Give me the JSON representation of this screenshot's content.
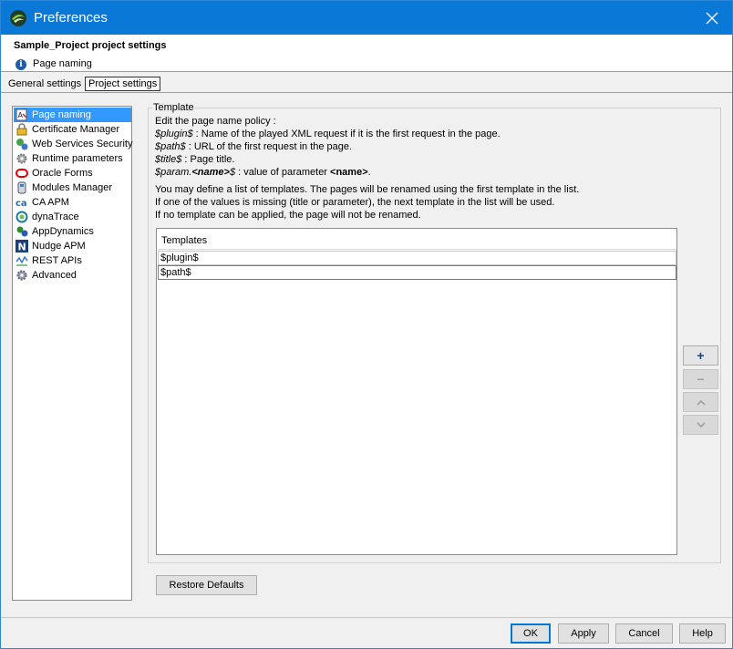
{
  "window": {
    "title": "Preferences"
  },
  "header": {
    "project_title": "Sample_Project project settings",
    "page_label": "Page naming"
  },
  "tabs": [
    {
      "label": "General settings",
      "active": false
    },
    {
      "label": "Project settings",
      "active": true
    }
  ],
  "sidebar": {
    "items": [
      {
        "label": "Page naming",
        "icon": "page-naming-icon",
        "selected": true
      },
      {
        "label": "Certificate Manager",
        "icon": "certificate-icon"
      },
      {
        "label": "Web Services Security",
        "icon": "web-services-icon"
      },
      {
        "label": "Runtime parameters",
        "icon": "runtime-gear-icon"
      },
      {
        "label": "Oracle Forms",
        "icon": "oracle-icon"
      },
      {
        "label": "Modules Manager",
        "icon": "modules-icon"
      },
      {
        "label": "CA APM",
        "icon": "ca-icon"
      },
      {
        "label": "dynaTrace",
        "icon": "dynatrace-icon"
      },
      {
        "label": "AppDynamics",
        "icon": "appdynamics-icon"
      },
      {
        "label": "Nudge APM",
        "icon": "nudge-icon"
      },
      {
        "label": "REST APIs",
        "icon": "rest-icon"
      },
      {
        "label": "Advanced",
        "icon": "advanced-gear-icon"
      }
    ]
  },
  "template": {
    "group_label": "Template",
    "intro": "Edit the page name policy :",
    "plugin_token": "$plugin$",
    "plugin_desc": ": Name of the played XML request if it is the first request in the page.",
    "path_token": "$path$",
    "path_desc": ": URL of the first request in the page.",
    "title_token": "$title$",
    "title_desc": ": Page title.",
    "param_token_a": "$param.",
    "param_token_b": "<name>",
    "param_token_c": "$",
    "param_desc_a": ": value of parameter ",
    "param_desc_b": "<name>",
    "param_desc_c": ".",
    "info_line1": "You may define a list of templates. The pages will be renamed using the first template in the list.",
    "info_line2": "If one of the values is missing (title or parameter), the next template in the list will be used.",
    "info_line3": "If no template can be applied, the page will not be renamed.",
    "table_header": "Templates",
    "rows": [
      "$plugin$",
      "$path$"
    ]
  },
  "side_buttons": {
    "add": "+",
    "remove": "−",
    "up": "up-chevron",
    "down": "down-chevron"
  },
  "restore_label": "Restore Defaults",
  "footer": {
    "ok": "OK",
    "apply": "Apply",
    "cancel": "Cancel",
    "help": "Help"
  },
  "colors": {
    "titlebar": "#0a78d7",
    "selection": "#3399ff",
    "default_button_border": "#0078d7"
  }
}
